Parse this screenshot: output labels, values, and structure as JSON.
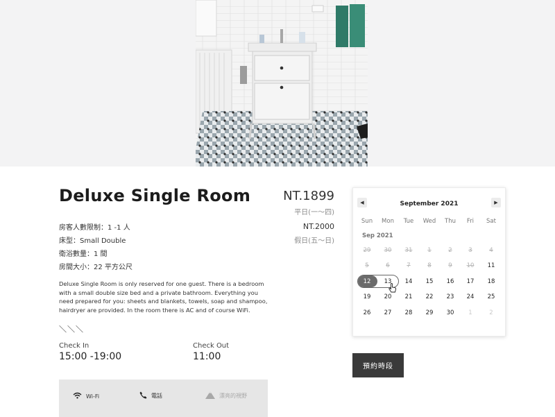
{
  "room": {
    "title": "Deluxe Single Room",
    "price_weekday": "NT.1899",
    "price_weekday_label": "平日(一～四)",
    "price_weekend": "NT.2000",
    "price_weekend_label": "假日(五～日)"
  },
  "specs": [
    "房客人數限制：1 -1 人",
    "床型：Small Double",
    "衛浴數量：1 間",
    "房間大小：22 平方公尺"
  ],
  "description": "Deluxe Single Room is only reserved for one guest. There is a bedroom with a small double size bed and a private bathroom. Everything you need prepared for you: sheets and blankets, towels, soap and shampoo, hairdryer are provided. In the room there is AC and of course WiFi.",
  "divider": "＼＼＼",
  "checkin": {
    "label": "Check In",
    "time": "15:00 -19:00"
  },
  "checkout": {
    "label": "Check Out",
    "time": "11:00"
  },
  "amenities": [
    {
      "label": "Wi-Fi",
      "icon": "wifi-icon",
      "available": true
    },
    {
      "label": "電話",
      "icon": "phone-icon",
      "available": true
    },
    {
      "label": "漂亮的視野",
      "icon": "mountain-icon",
      "available": false
    }
  ],
  "calendar": {
    "month_title": "September 2021",
    "month_short": "Sep 2021",
    "weekdays": [
      "Sun",
      "Mon",
      "Tue",
      "Wed",
      "Thu",
      "Fri",
      "Sat"
    ],
    "weeks": [
      [
        "29",
        "30",
        "31",
        "1",
        "2",
        "3",
        "4"
      ],
      [
        "5",
        "6",
        "7",
        "8",
        "9",
        "10",
        "11"
      ],
      [
        "12",
        "13",
        "14",
        "15",
        "16",
        "17",
        "18"
      ],
      [
        "19",
        "20",
        "21",
        "22",
        "23",
        "24",
        "25"
      ],
      [
        "26",
        "27",
        "28",
        "29",
        "30",
        "1",
        "2"
      ]
    ],
    "selected_start": "12",
    "selected_end": "13",
    "prev_icon": "chevron-left-icon",
    "next_icon": "chevron-right-icon"
  },
  "book_button": "預約時段",
  "colors": {
    "accent": "#3a3a3a",
    "selected": "#6b6b6b",
    "amenity_bg": "#e6e6e6"
  }
}
